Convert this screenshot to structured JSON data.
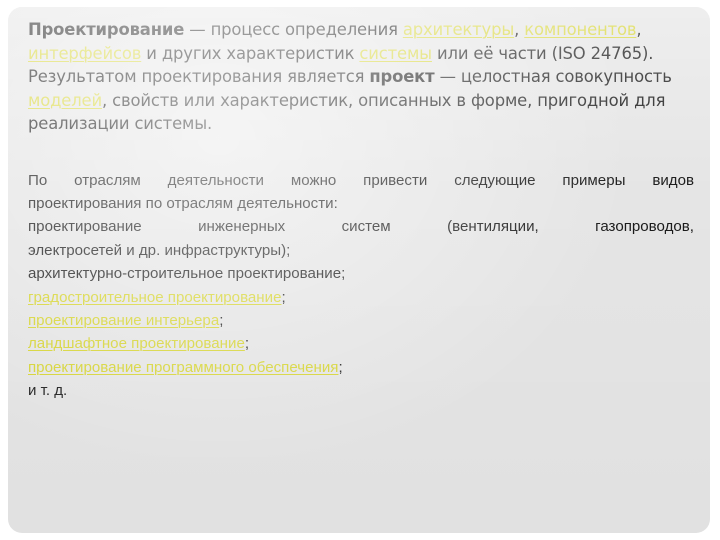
{
  "slide": {
    "background_color": "#ffffff",
    "card_color": "#e5e5e5",
    "link_color": "#d6d42e",
    "text_color": "#1b1b1b"
  },
  "intro": {
    "term": "Проектирование",
    "seg_1": " — процесс определения ",
    "link_architecture": "архитектуры",
    "seg_2": ", ",
    "link_components": "компонентов",
    "seg_3": ", ",
    "link_interfaces": "интерфейсов",
    "seg_4": " и других характеристик ",
    "link_system": "системы",
    "seg_5": " или её части (ISO 24765). Результатом проектирования является ",
    "term_2": "проект",
    "seg_6": " — целостная совокупность ",
    "link_models": "моделей",
    "seg_7": ", свойств или характеристик, описанных в форме, пригодной для реализации системы."
  },
  "body": {
    "lead_line_1": "По отраслям деятельности можно привести следующие примеры видов",
    "lead_line_2": "проектирования по отраслям деятельности:",
    "item_engineering_line_1": "проектирование инженерных систем (вентиляции, газопроводов,",
    "item_engineering_line_2": "электросетей и др. инфраструктуры);",
    "item_architectural": "архитектурно-строительное проектирование;",
    "link_urban": "градостроительное проектирование",
    "link_interior": "проектирование интерьера",
    "link_landscape": "ландшафтное проектирование",
    "link_software": "проектирование программного обеспечения",
    "semicolon": ";",
    "etc": "и т. д."
  }
}
